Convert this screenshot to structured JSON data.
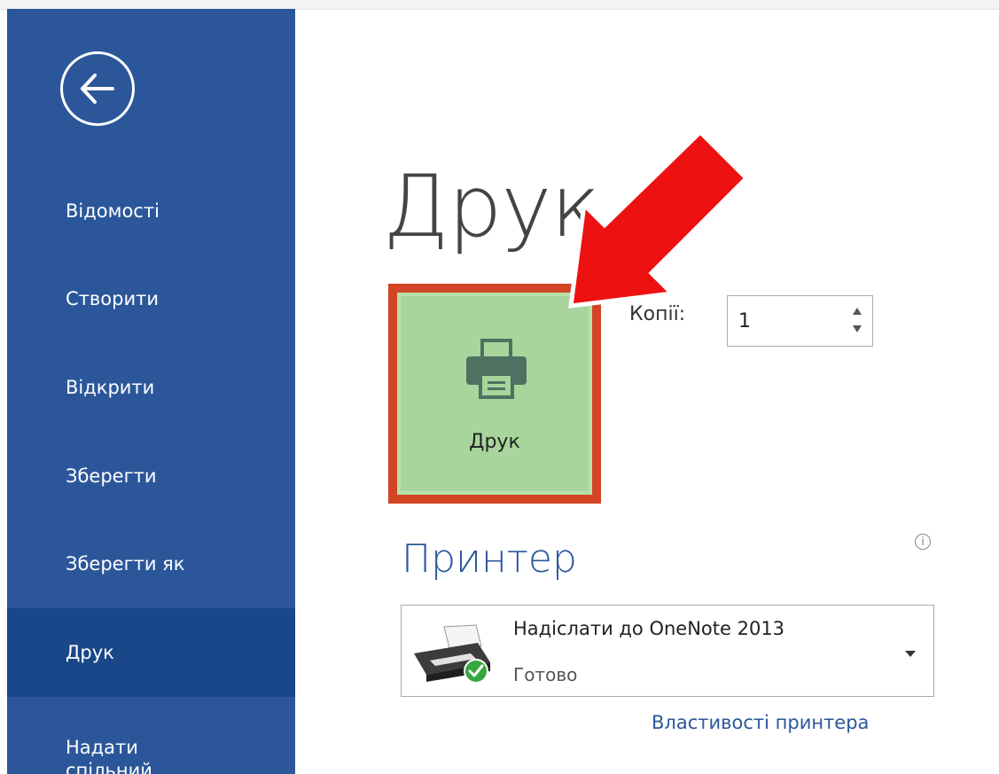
{
  "sidebar": {
    "back_icon": "back-arrow-circle-icon",
    "items": [
      {
        "label": "Відомості"
      },
      {
        "label": "Створити"
      },
      {
        "label": "Відкрити"
      },
      {
        "label": "Зберегти"
      },
      {
        "label": "Зберегти як"
      },
      {
        "label": "Друк",
        "active": true
      },
      {
        "label": "Надати спільний доступ"
      }
    ]
  },
  "main": {
    "title": "Друк",
    "print_button": {
      "label": "Друк",
      "icon": "printer-icon"
    },
    "copies": {
      "label": "Копії:",
      "value": "1"
    },
    "printer_section": {
      "title": "Принтер",
      "info_icon": "info-icon",
      "printer_name": "Надіслати до OneNote 2013",
      "printer_status": "Готово",
      "properties_link": "Властивості принтера"
    }
  },
  "annotation": {
    "arrow_color": "#ee1111",
    "highlight_color": "#d14524"
  },
  "colors": {
    "sidebar": "#2b579a",
    "sidebar_active": "#19478a",
    "button_fill": "#a7d59c",
    "accent": "#2b579a"
  }
}
